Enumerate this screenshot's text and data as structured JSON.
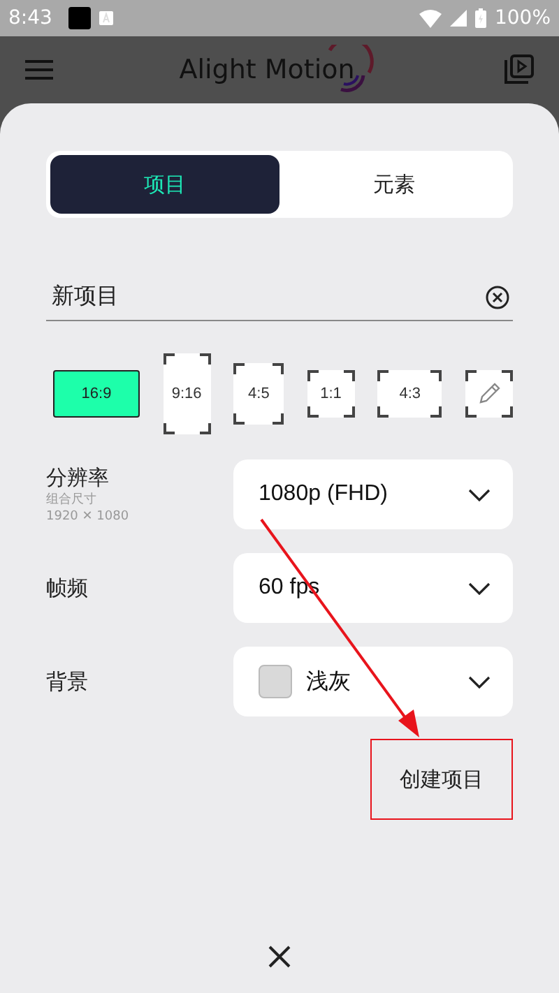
{
  "status_bar": {
    "time": "8:43",
    "battery": "100%"
  },
  "app_bar": {
    "title": "Alight Motion"
  },
  "tabs": [
    {
      "label": "项目",
      "selected": true
    },
    {
      "label": "元素",
      "selected": false
    }
  ],
  "name_field": {
    "value": "新项目"
  },
  "aspect_ratios": [
    {
      "kind": "ratio",
      "label": "16:9",
      "selected": true
    },
    {
      "kind": "ratio",
      "label": "9:16",
      "selected": false
    },
    {
      "kind": "ratio",
      "label": "4:5",
      "selected": false
    },
    {
      "kind": "ratio",
      "label": "1:1",
      "selected": false
    },
    {
      "kind": "ratio",
      "label": "4:3",
      "selected": false
    },
    {
      "kind": "custom",
      "selected": false
    }
  ],
  "settings": [
    {
      "label": "分辨率",
      "sublabels": [
        "组合尺寸",
        "1920 ✕ 1080"
      ],
      "value": "1080p (FHD)"
    },
    {
      "label": "帧频",
      "value": "60 fps"
    },
    {
      "label": "背景",
      "value": "浅灰",
      "color": "#d9d9d9"
    }
  ],
  "create_button": {
    "label": "创建项目"
  }
}
